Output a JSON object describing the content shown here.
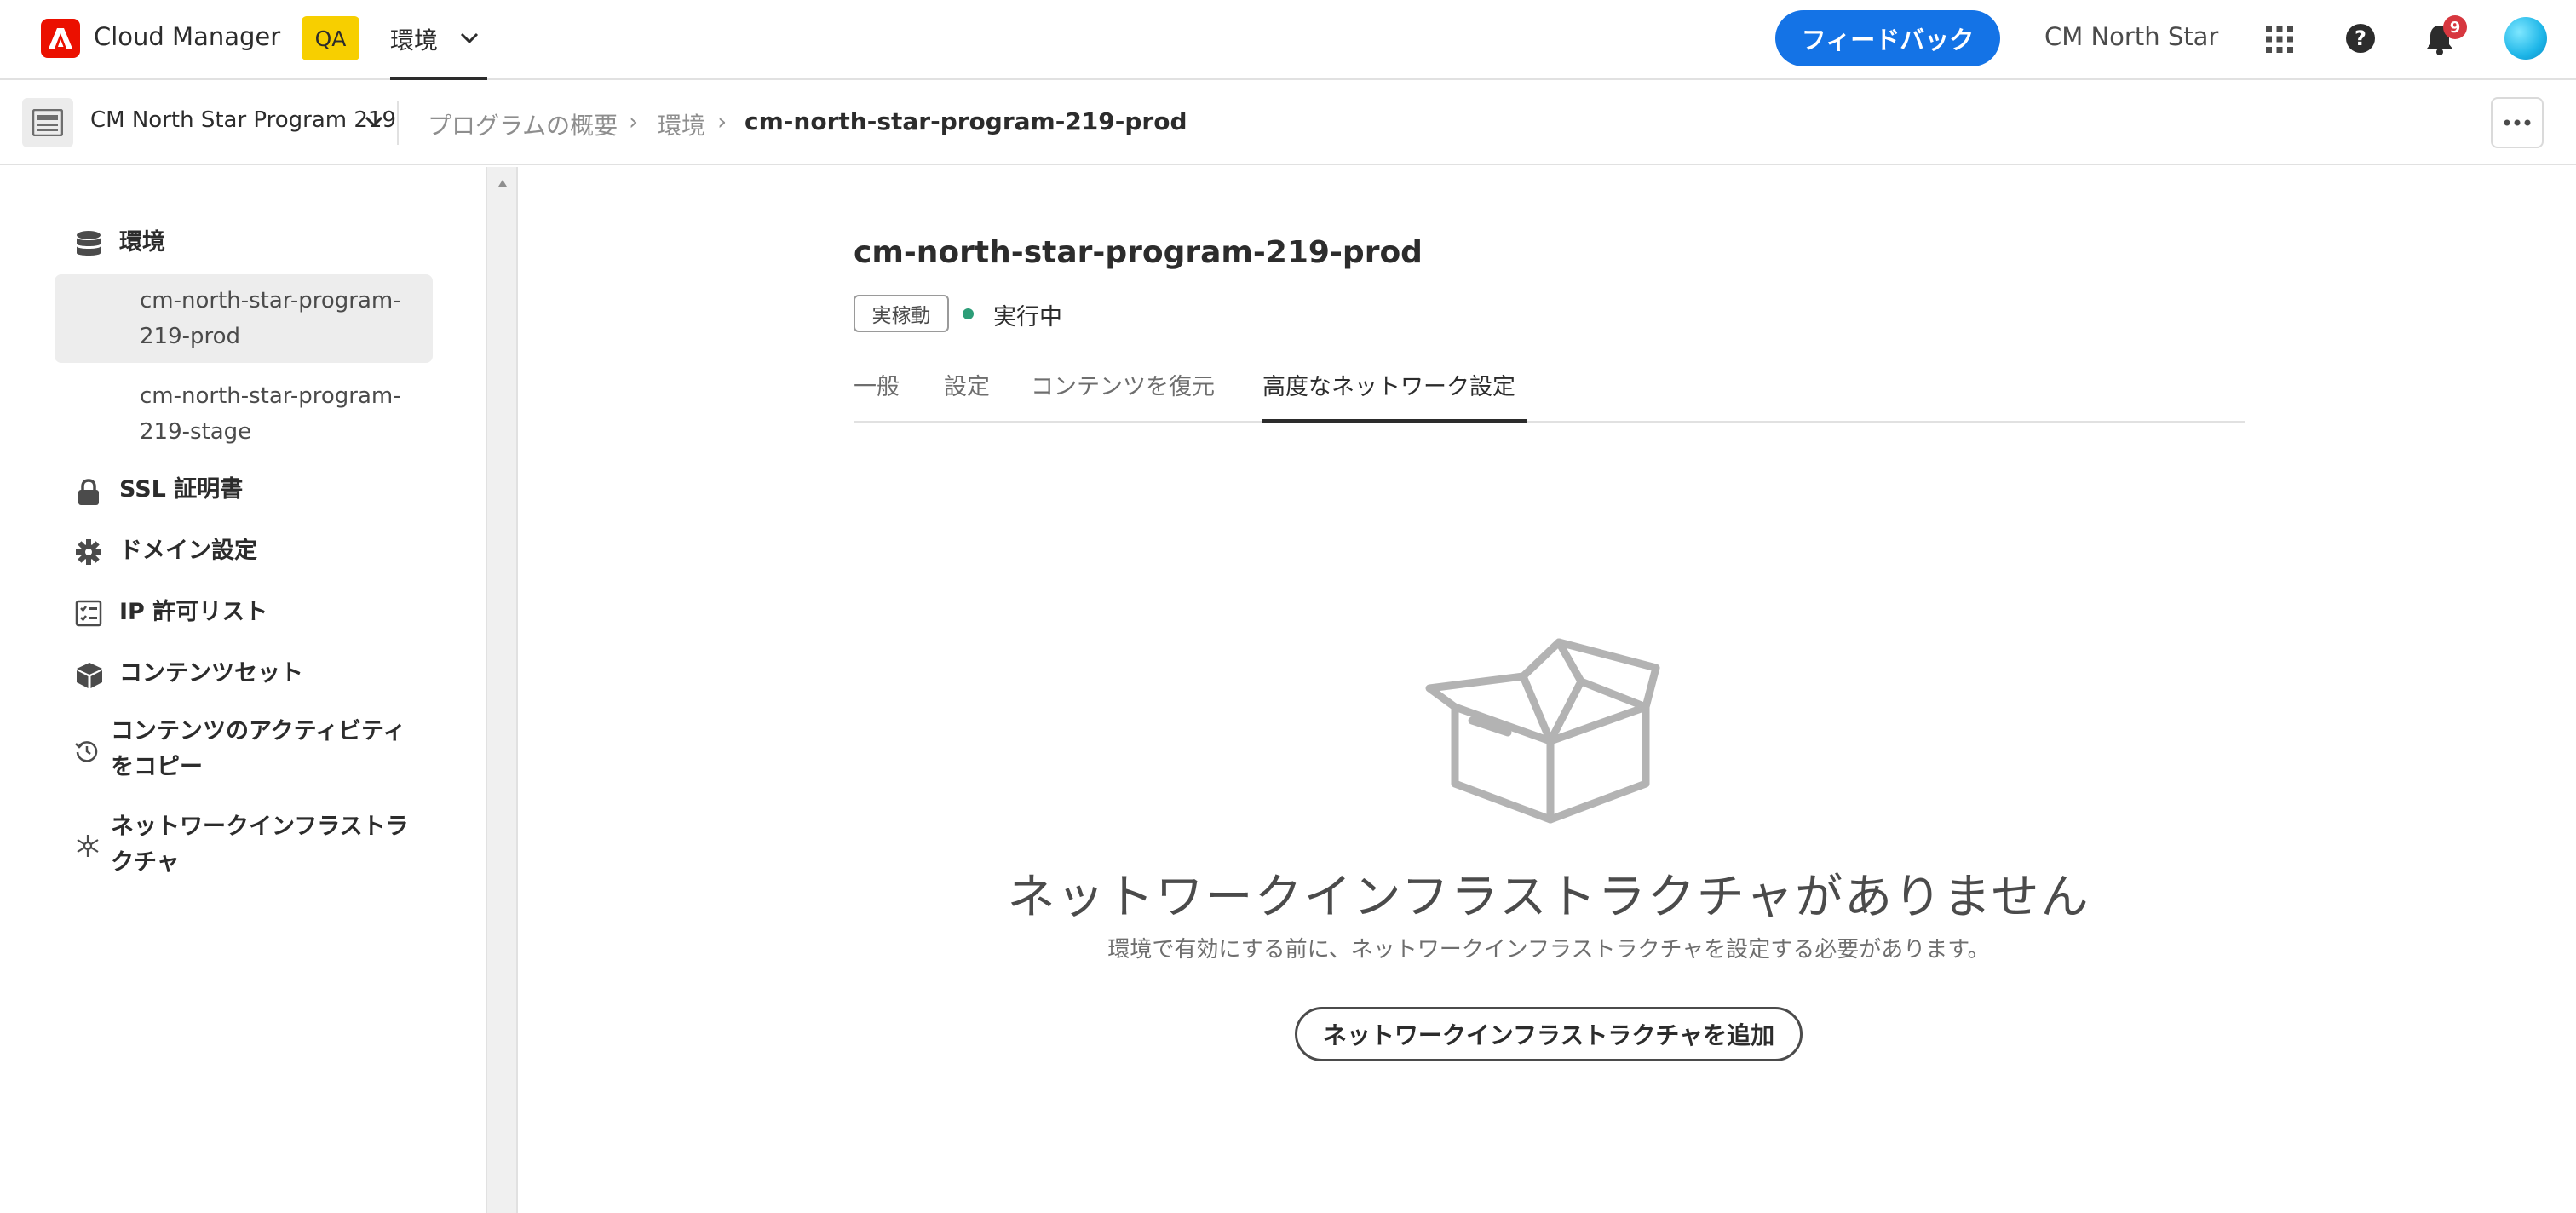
{
  "header": {
    "app_name": "Cloud Manager",
    "env_badge": "QA",
    "section": "環境",
    "feedback_label": "フィードバック",
    "org_name": "CM North Star",
    "notification_count": "9"
  },
  "breadcrumb": {
    "program_name": "CM North Star Program 219",
    "items": [
      "プログラムの概要",
      "環境",
      "cm-north-star-program-219-prod"
    ],
    "separator": "›"
  },
  "sidebar": {
    "environments_label": "環境",
    "environments": [
      {
        "label": "cm-north-star-program-219-prod",
        "selected": true
      },
      {
        "label": "cm-north-star-program-219-stage",
        "selected": false
      }
    ],
    "items": [
      {
        "label": "SSL 証明書",
        "icon": "lock-icon"
      },
      {
        "label": "ドメイン設定",
        "icon": "gear-icon"
      },
      {
        "label": "IP 許可リスト",
        "icon": "checklist-icon"
      },
      {
        "label": "コンテンツセット",
        "icon": "box-icon"
      },
      {
        "label": "コンテンツのアクティビティをコピー",
        "icon": "history-icon"
      },
      {
        "label": "ネットワークインフラストラクチャ",
        "icon": "network-icon"
      }
    ]
  },
  "main": {
    "title": "cm-north-star-program-219-prod",
    "type_tag": "実稼動",
    "status": "実行中",
    "status_color": "#2d9d78",
    "tabs": [
      {
        "label": "一般",
        "active": false
      },
      {
        "label": "設定",
        "active": false
      },
      {
        "label": "コンテンツを復元",
        "active": false
      },
      {
        "label": "高度なネットワーク設定",
        "active": true
      }
    ],
    "empty_state": {
      "heading": "ネットワークインフラストラクチャがありません",
      "description": "環境で有効にする前に、ネットワークインフラストラクチャを設定する必要があります。",
      "button_label": "ネットワークインフラストラクチャを追加"
    }
  },
  "colors": {
    "accent": "#1473e6",
    "brand": "#eb1000",
    "badge": "#f7cf00",
    "notification": "#d7373f"
  }
}
